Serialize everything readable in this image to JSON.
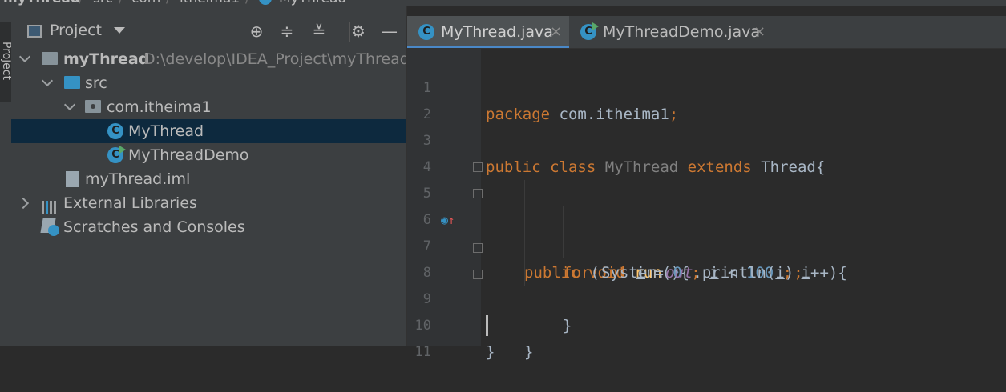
{
  "breadcrumb": [
    "myThread",
    "src",
    "com",
    "itheima1",
    "MyThread"
  ],
  "sidebar": {
    "tool_window_label": "Project"
  },
  "project_panel": {
    "view_label": "Project",
    "tree": [
      {
        "label": "myThread",
        "path": "D:\\develop\\IDEA_Project\\myThread"
      },
      {
        "label": "src"
      },
      {
        "label": "com.itheima1"
      },
      {
        "label": "MyThread"
      },
      {
        "label": "MyThreadDemo"
      },
      {
        "label": "myThread.iml"
      },
      {
        "label": "External Libraries"
      },
      {
        "label": "Scratches and Consoles"
      }
    ]
  },
  "editor": {
    "tabs": [
      {
        "label": "MyThread.java",
        "active": true
      },
      {
        "label": "MyThreadDemo.java",
        "active": false
      }
    ],
    "line_numbers": [
      "1",
      "2",
      "3",
      "4",
      "5",
      "6",
      "7",
      "8",
      "9",
      "10",
      "11"
    ],
    "lines": {
      "l1": [
        "package",
        " com.itheima1",
        ";"
      ],
      "l3": [
        "public class",
        " MyThread ",
        "extends",
        " Thread{"
      ],
      "l5": [
        "public void",
        " run",
        "(){"
      ],
      "l6": [
        "for",
        "(",
        "int",
        " ",
        "i",
        " = ",
        "0",
        " ; ",
        "i",
        " < ",
        "100",
        " ; ",
        "i",
        "++){"
      ],
      "l7": [
        "System.",
        "out",
        ".println(",
        "i",
        ")",
        ";"
      ],
      "l8": [
        "}"
      ],
      "l9": [
        "}"
      ],
      "l10": [
        "}"
      ]
    }
  },
  "colors": {
    "keyword": "#cc7832",
    "number": "#6897bb",
    "field": "#9876aa",
    "method": "#ffc66d",
    "accent": "#3592c4"
  }
}
